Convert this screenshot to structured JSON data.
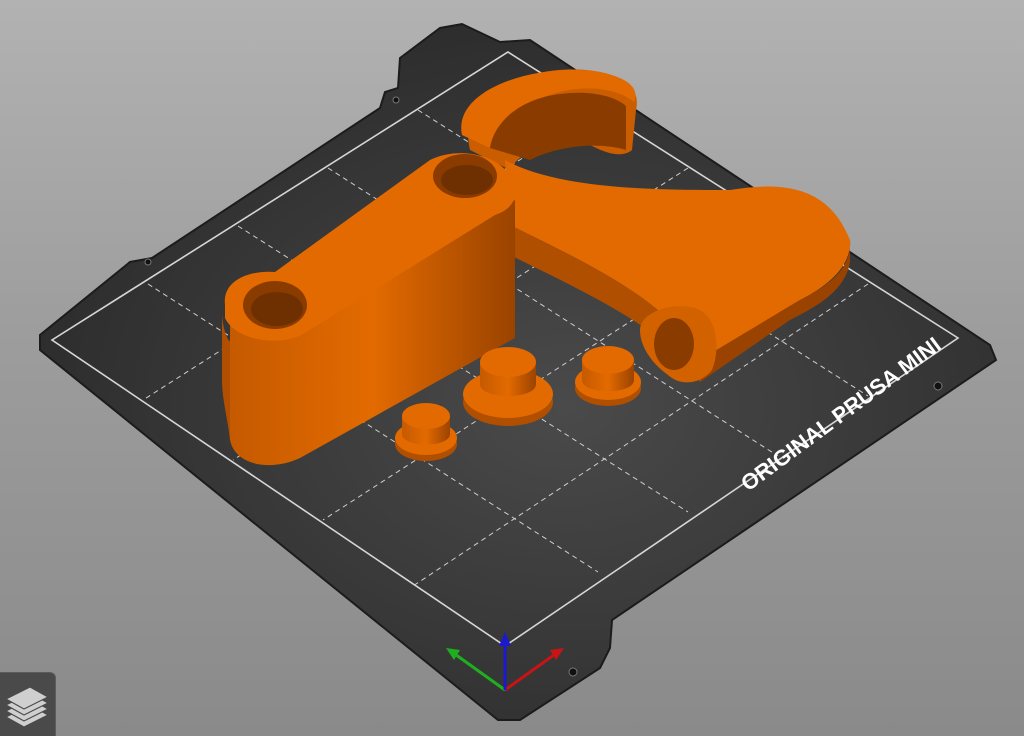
{
  "app": {
    "view": "3D plater"
  },
  "bed": {
    "label": "ORIGINAL PRUSA MINI",
    "color": "#2e2e2e",
    "edge_color": "#1c1c1c",
    "grid_color": "#cfcfcf",
    "label_color": "#ffffff"
  },
  "objects": {
    "color": "#e36a00",
    "shade_color": "#b04f00",
    "dark_color": "#7d3600",
    "items": [
      {
        "name": "arm-bar"
      },
      {
        "name": "clamp-arm"
      },
      {
        "name": "small-peg-left"
      },
      {
        "name": "stepped-peg-middle"
      },
      {
        "name": "small-peg-right"
      }
    ]
  },
  "axes": {
    "x_color": "#c81414",
    "y_color": "#1fae1f",
    "z_color": "#1a1acc"
  },
  "toolbar": {
    "layers_icon": "layers-icon",
    "layers_bg": "#4a4a4a"
  }
}
